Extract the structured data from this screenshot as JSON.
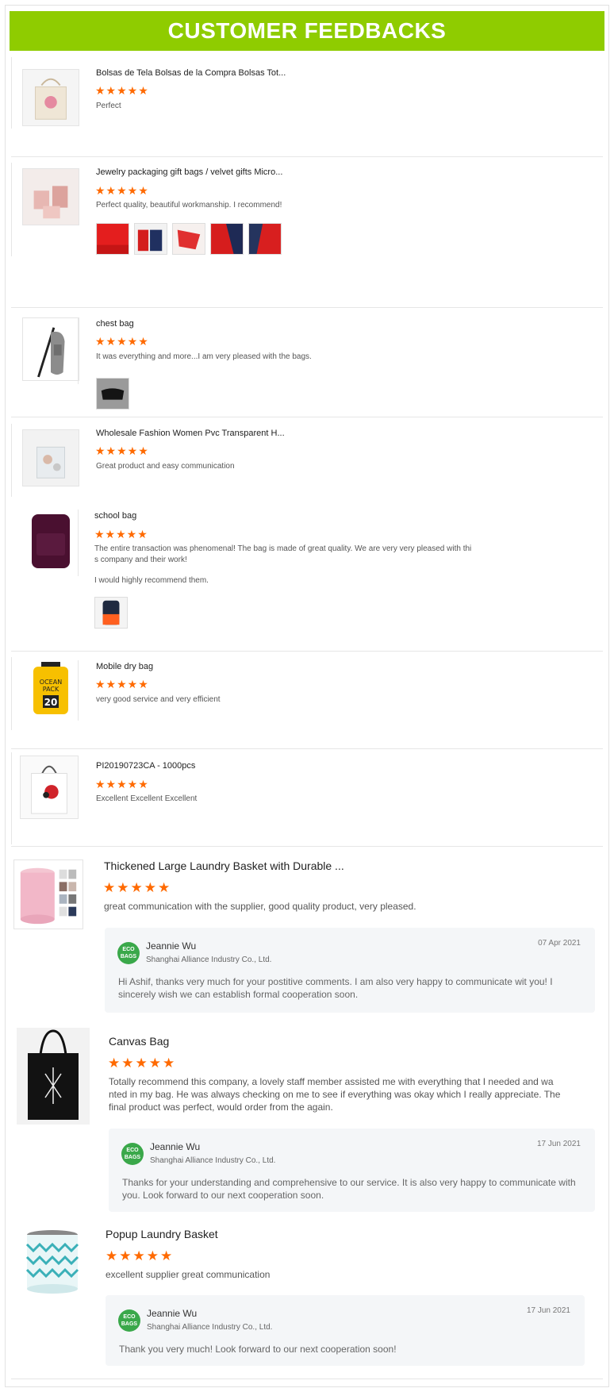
{
  "header": {
    "title": "CUSTOMER FEEDBACKS"
  },
  "rating_stars": "★★★★★",
  "reviews": [
    {
      "title": "Bolsas de Tela Bolsas de la Compra Bolsas Tot...",
      "text": "Perfect"
    },
    {
      "title": "Jewelry packaging gift bags / velvet gifts Micro...",
      "text": "Perfect quality, beautiful workmanship. I recommend!"
    },
    {
      "title": "chest bag",
      "text": "It was everything and more...I am very pleased with the bags."
    },
    {
      "title": "Wholesale Fashion Women Pvc Transparent H...",
      "text": "Great product and easy communication"
    },
    {
      "title": "school bag",
      "text": "The entire transaction was phenomenal! The bag is made of great quality. We are very very pleased with thi s company and their work!",
      "text2": "I would highly recommend them."
    },
    {
      "title": "Mobile dry bag",
      "text": "very good service and very efficient"
    },
    {
      "title": "PI20190723CA - 1000pcs",
      "text": "Excellent Excellent Excellent"
    },
    {
      "title": "Thickened Large Laundry Basket with Durable ...",
      "text": "great communication with the supplier, good quality product, very pleased."
    },
    {
      "title": "Canvas Bag",
      "text": "Totally recommend this company, a lovely staff member assisted me with everything that I needed and wa nted in my bag. He was always checking on me to see if everything was okay which I really appreciate. The final product was perfect, would order from the again."
    },
    {
      "title": "Popup Laundry Basket",
      "text": "excellent supplier great communication"
    }
  ],
  "replies": [
    {
      "avatar": "ECO BAGS",
      "name": "Jeannie Wu",
      "company": "Shanghai Alliance Industry Co., Ltd.",
      "date": "07 Apr 2021",
      "text": "Hi Ashif, thanks very much for your postitive comments. I am also very happy to communicate wit you! I sincerely wish we can establish formal cooperation soon."
    },
    {
      "avatar": "ECO BAGS",
      "name": "Jeannie Wu",
      "company": "Shanghai Alliance Industry Co., Ltd.",
      "date": "17 Jun 2021",
      "text": "Thanks for your understanding and comprehensive to our service. It is also very happy to communicate with you. Look forward to our next cooperation soon."
    },
    {
      "avatar": "ECO BAGS",
      "name": "Jeannie Wu",
      "company": "Shanghai Alliance Industry Co., Ltd.",
      "date": "17 Jun 2021",
      "text": "Thank you very much! Look forward to our next cooperation soon!"
    }
  ],
  "ocean_pack": {
    "line1": "OCEAN",
    "line2": "PACK",
    "number": "20"
  },
  "colors": {
    "banner": "#8fcc00",
    "stars": "#ff6a00",
    "avatar": "#3aa84a",
    "reply_bg": "#f4f6f8"
  }
}
